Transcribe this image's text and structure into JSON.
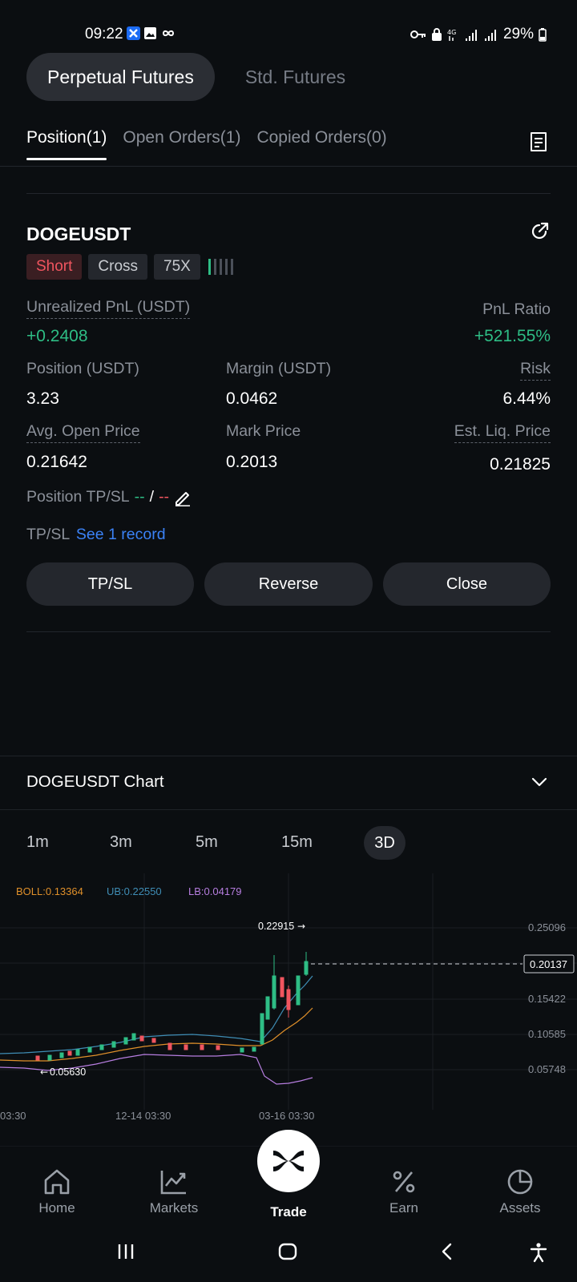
{
  "status_bar": {
    "time": "09:22",
    "battery": "29%"
  },
  "mode_switch": {
    "active": "Perpetual Futures",
    "inactive": "Std. Futures"
  },
  "tabs": [
    {
      "label": "Position(1)"
    },
    {
      "label": "Open Orders(1)"
    },
    {
      "label": "Copied Orders(0)"
    }
  ],
  "position": {
    "symbol": "DOGEUSDT",
    "side": "Short",
    "margin_mode": "Cross",
    "leverage": "75X",
    "unrealized_pnl_label": "Unrealized PnL (USDT)",
    "unrealized_pnl_value": "+0.2408",
    "pnl_ratio_label": "PnL Ratio",
    "pnl_ratio_value": "+521.55%",
    "position_label": "Position (USDT)",
    "position_value": "3.23",
    "margin_label": "Margin (USDT)",
    "margin_value": "0.0462",
    "risk_label": "Risk",
    "risk_value": "6.44%",
    "avg_open_label": "Avg. Open Price",
    "avg_open_value": "0.21642",
    "mark_price_label": "Mark Price",
    "mark_price_value": "0.2013",
    "liq_price_label": "Est. Liq. Price",
    "liq_price_value": "0.21825",
    "tpsl_label": "Position TP/SL",
    "tp_value": "--",
    "slash": "/",
    "sl_value": "--",
    "tpsl_record_label": "TP/SL",
    "tpsl_record_link": "See 1 record"
  },
  "actions": {
    "tpsl": "TP/SL",
    "reverse": "Reverse",
    "close": "Close"
  },
  "chart": {
    "title": "DOGEUSDT Chart",
    "timeframes": [
      "1m",
      "3m",
      "5m",
      "15m",
      "3D"
    ],
    "active_timeframe": "3D",
    "indicators": {
      "boll": "BOLL:0.13364",
      "ub": "UB:0.22550",
      "lb": "LB:0.04179"
    },
    "colors": {
      "boll": "#e0902a",
      "ub": "#3f8db5",
      "lb": "#b77ee0",
      "up": "#2ebd85",
      "down": "#f0555f"
    },
    "price_axis": [
      "0.25096",
      "0.20137",
      "0.15422",
      "0.10585",
      "0.05748"
    ],
    "current_price_tag": "0.20137",
    "high_label": "0.22915",
    "low_label": "0.05630",
    "time_axis": [
      "03:30",
      "12-14 03:30",
      "03-16 03:30"
    ]
  },
  "bottom_nav": [
    {
      "label": "Home",
      "icon": "home-icon"
    },
    {
      "label": "Markets",
      "icon": "markets-icon"
    },
    {
      "label": "Trade",
      "icon": "trade-icon"
    },
    {
      "label": "Earn",
      "icon": "percent-icon"
    },
    {
      "label": "Assets",
      "icon": "pie-icon"
    }
  ]
}
